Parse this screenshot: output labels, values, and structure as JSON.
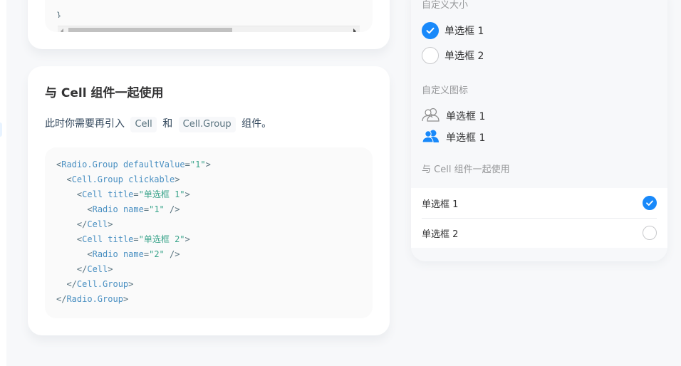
{
  "prev_card": {
    "code_tail": "}"
  },
  "doc": {
    "heading": "与 Cell 组件一起使用",
    "desc_prefix": "此时你需要再引入",
    "code1": "Cell",
    "desc_and": "和",
    "code2": "Cell.Group",
    "desc_suffix": "组件。",
    "code_lines": [
      {
        "indent": "",
        "parts": [
          [
            "p",
            "<"
          ],
          [
            "tag",
            "Radio.Group "
          ],
          [
            "attr",
            "defaultValue"
          ],
          [
            "p",
            "="
          ],
          [
            "str",
            "\"1\""
          ],
          [
            "p",
            ">"
          ]
        ]
      },
      {
        "indent": "  ",
        "parts": [
          [
            "p",
            "<"
          ],
          [
            "tag",
            "Cell.Group "
          ],
          [
            "attr",
            "clickable"
          ],
          [
            "p",
            ">"
          ]
        ]
      },
      {
        "indent": "    ",
        "parts": [
          [
            "p",
            "<"
          ],
          [
            "tag",
            "Cell "
          ],
          [
            "attr",
            "title"
          ],
          [
            "p",
            "="
          ],
          [
            "str",
            "\"单选框 1\""
          ],
          [
            "p",
            ">"
          ]
        ]
      },
      {
        "indent": "      ",
        "parts": [
          [
            "p",
            "<"
          ],
          [
            "tag",
            "Radio "
          ],
          [
            "attr",
            "name"
          ],
          [
            "p",
            "="
          ],
          [
            "str",
            "\"1\""
          ],
          [
            "p",
            " />"
          ]
        ]
      },
      {
        "indent": "    ",
        "parts": [
          [
            "p",
            "</"
          ],
          [
            "tag",
            "Cell"
          ],
          [
            "p",
            ">"
          ]
        ]
      },
      {
        "indent": "    ",
        "parts": [
          [
            "p",
            "<"
          ],
          [
            "tag",
            "Cell "
          ],
          [
            "attr",
            "title"
          ],
          [
            "p",
            "="
          ],
          [
            "str",
            "\"单选框 2\""
          ],
          [
            "p",
            ">"
          ]
        ]
      },
      {
        "indent": "      ",
        "parts": [
          [
            "p",
            "<"
          ],
          [
            "tag",
            "Radio "
          ],
          [
            "attr",
            "name"
          ],
          [
            "p",
            "="
          ],
          [
            "str",
            "\"2\""
          ],
          [
            "p",
            " />"
          ]
        ]
      },
      {
        "indent": "    ",
        "parts": [
          [
            "p",
            "</"
          ],
          [
            "tag",
            "Cell"
          ],
          [
            "p",
            ">"
          ]
        ]
      },
      {
        "indent": "  ",
        "parts": [
          [
            "p",
            "</"
          ],
          [
            "tag",
            "Cell.Group"
          ],
          [
            "p",
            ">"
          ]
        ]
      },
      {
        "indent": "",
        "parts": [
          [
            "p",
            "</"
          ],
          [
            "tag",
            "Radio.Group"
          ],
          [
            "p",
            ">"
          ]
        ]
      }
    ]
  },
  "demo": {
    "custom_size": {
      "title": "自定义大小",
      "options": [
        {
          "label": "单选框 1",
          "checked": true
        },
        {
          "label": "单选框 2",
          "checked": false
        }
      ]
    },
    "custom_icon": {
      "title": "自定义图标",
      "options": [
        {
          "label": "单选框 1",
          "icon": "user-outline-icon"
        },
        {
          "label": "单选框 1",
          "icon": "user-filled-icon"
        }
      ]
    },
    "with_cell": {
      "title": "与 Cell 组件一起使用",
      "cells": [
        {
          "label": "单选框 1",
          "checked": true
        },
        {
          "label": "单选框 2",
          "checked": false
        }
      ]
    }
  },
  "colors": {
    "accent": "#1989fa",
    "border": "#c8c9cc",
    "muted_text": "#969799"
  }
}
